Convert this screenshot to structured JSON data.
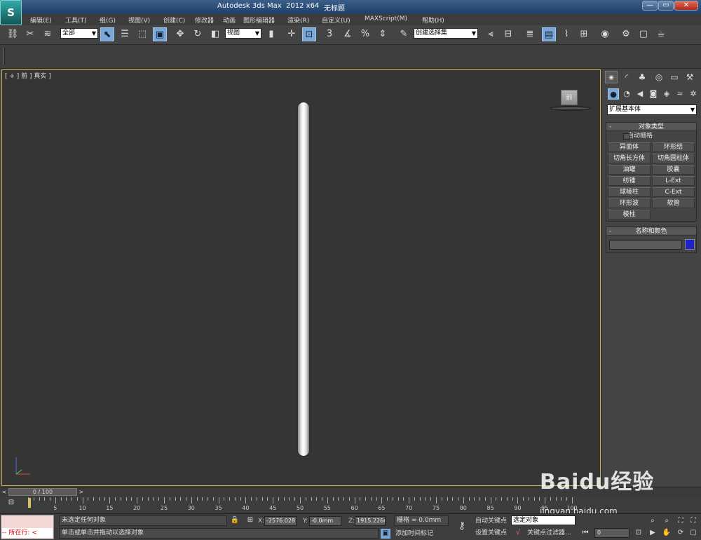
{
  "window": {
    "title": "Autodesk 3ds Max  2012 x64",
    "document": "无标题",
    "buttons": {
      "minimize": "—",
      "maximize": "▭",
      "close": "✕"
    }
  },
  "menu": [
    "编辑(E)",
    "工具(T)",
    "组(G)",
    "视图(V)",
    "创建(C)",
    "修改器",
    "动画",
    "图形编辑器",
    "渲染(R)",
    "自定义(U)",
    "MAXScript(M)",
    "帮助(H)"
  ],
  "toolbar": {
    "selection_filter": "全部",
    "reference_coord": "视图",
    "named_selection": "创建选择集",
    "snap_label": "3"
  },
  "viewport": {
    "label": "[ + ] 前 ] 真实 ]",
    "viewcube_face": "前"
  },
  "command_panel": {
    "category": "扩展基本体",
    "rollouts": {
      "object_type": {
        "title": "对象类型",
        "toggle": "-",
        "autogrid": "自动栅格",
        "buttons": [
          "异面体",
          "环形结",
          "切角长方体",
          "切角圆柱体",
          "油罐",
          "胶囊",
          "纺锤",
          "L-Ext",
          "球棱柱",
          "C-Ext",
          "环形波",
          "软管",
          "棱柱"
        ]
      },
      "name_color": {
        "title": "名称和颜色",
        "toggle": "-",
        "color": "#1e22c8"
      }
    }
  },
  "timeslider": {
    "position": "0 / 100",
    "prev": "<",
    "next": ">"
  },
  "track": {
    "ticks": [
      0,
      5,
      10,
      15,
      20,
      25,
      30,
      35,
      40,
      45,
      50,
      55,
      60,
      65,
      70,
      75,
      80,
      85,
      90,
      95,
      100
    ],
    "labels": [
      "5",
      "10",
      "15",
      "20",
      "25",
      "30",
      "35",
      "40",
      "45",
      "50",
      "55",
      "60",
      "65",
      "70",
      "75",
      "80",
      "85",
      "90",
      "95",
      "100"
    ]
  },
  "status": {
    "maxscript": "-- 所在行: <",
    "selection_status": "未选定任何对象",
    "prompt": "单击或单击并拖动以选择对象",
    "x_label": "X:",
    "x_value": "-2576.028",
    "y_label": "Y:",
    "y_value": "-0.0mm",
    "z_label": "Z:",
    "z_value": "1915.226m",
    "grid": "栅格 = 0.0mm",
    "add_time_tag": "添加时间标记",
    "auto_key": "自动关键点",
    "set_key": "设置关键点",
    "selected_object": "选定对象",
    "key_filters": "关键点过滤器...",
    "frame": "0"
  },
  "watermark": {
    "text": "Baidu经验",
    "url": "jingyan.baidu.com"
  }
}
